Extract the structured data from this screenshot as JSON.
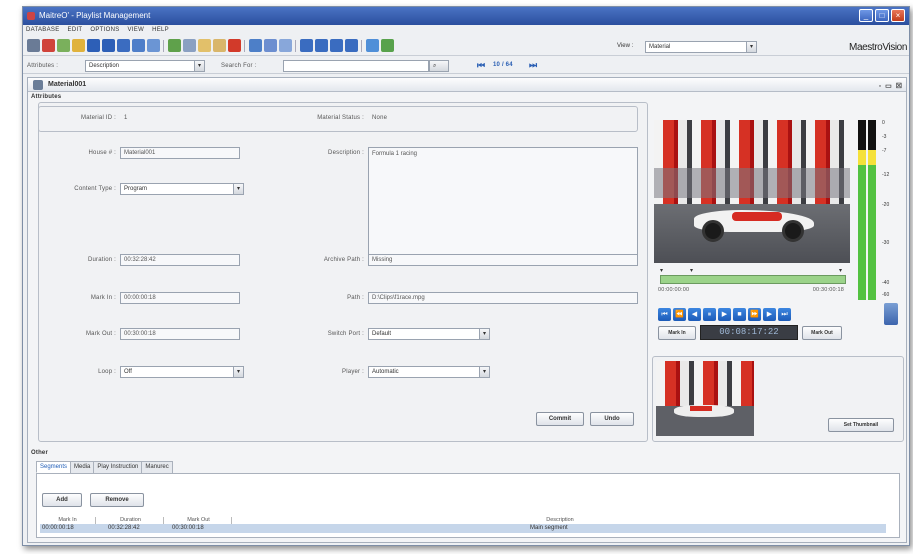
{
  "window": {
    "title": "MaitreO' - Playlist Management"
  },
  "menu": [
    "DATABASE",
    "EDIT",
    "OPTIONS",
    "VIEW",
    "HELP"
  ],
  "toolbar": {
    "view_label": "View :",
    "view_value": "Material",
    "brand": "MaestroVision"
  },
  "search": {
    "attributes_label": "Attributes :",
    "attributes_value": "Description",
    "search_label": "Search For :",
    "search_value": "",
    "page_indicator": "10 / 64"
  },
  "inner": {
    "title": "Material001"
  },
  "attributes": {
    "section_label": "Attributes",
    "material_id_label": "Material ID :",
    "material_id": "1",
    "material_status_label": "Material Status :",
    "material_status": "None",
    "house_label": "House # :",
    "house": "Material001",
    "description_label": "Description :",
    "description": "Formula 1 racing",
    "content_type_label": "Content Type :",
    "content_type": "Program",
    "duration_label": "Duration :",
    "duration": "00:32:28:42",
    "archive_path_label": "Archive Path :",
    "archive_path": "Missing",
    "mark_in_label": "Mark In :",
    "mark_in": "00:00:00:18",
    "path_label": "Path :",
    "path": "D:\\Clips\\f1race.mpg",
    "mark_out_label": "Mark Out :",
    "mark_out": "00:30:00:18",
    "switch_port_label": "Switch Port :",
    "switch_port": "Default",
    "loop_label": "Loop :",
    "loop": "Off",
    "player_label": "Player :",
    "player": "Automatic",
    "commit": "Commit",
    "undo": "Undo"
  },
  "player": {
    "tl_start": "00:00:00:00",
    "tl_end": "00:30:00:18",
    "mark_in_btn": "Mark In",
    "timecode": "00:08:17:22",
    "mark_out_btn": "Mark Out",
    "set_thumbnail": "Set Thumbnail",
    "vu_ticks": [
      "0",
      "-3",
      "-7",
      "-12",
      "-20",
      "-30",
      "-40",
      "-60"
    ]
  },
  "other": {
    "section_label": "Other",
    "tabs": [
      "Segments",
      "Media",
      "Play Instruction",
      "Manurec"
    ],
    "add": "Add",
    "remove": "Remove",
    "columns": [
      "Mark In",
      "Duration",
      "Mark Out",
      "Description"
    ],
    "rows": [
      {
        "mark_in": "00:00:00:18",
        "duration": "00:32:28:42",
        "mark_out": "00:30:00:18",
        "description": "Main segment"
      }
    ]
  },
  "colors": {
    "accent": "#2a5fb4",
    "title_bar": "#2b4f9e",
    "row_highlight": "#c6d6ea"
  }
}
